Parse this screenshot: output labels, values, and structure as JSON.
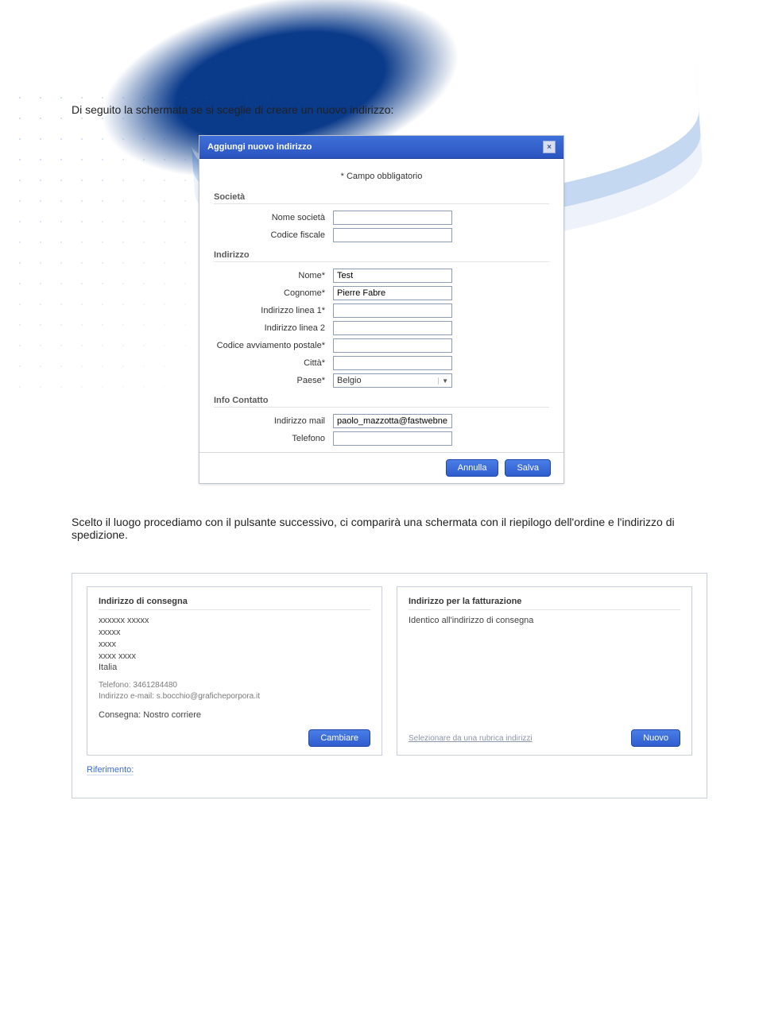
{
  "intro_text_1": "Di seguito la schermata se si sceglie di creare un nuovo indirizzo:",
  "intro_text_2": "Scelto il luogo procediamo con il pulsante successivo, ci comparirà una schermata con il riepilogo dell'ordine e l'indirizzo di spedizione.",
  "modal": {
    "title": "Aggiungi nuovo indirizzo",
    "required_note": "* Campo obbligatorio",
    "sections": {
      "societa": {
        "label": "Società",
        "nome_societa_label": "Nome società",
        "nome_societa_value": "",
        "codice_fiscale_label": "Codice fiscale",
        "codice_fiscale_value": ""
      },
      "indirizzo": {
        "label": "Indirizzo",
        "nome_label": "Nome*",
        "nome_value": "Test",
        "cognome_label": "Cognome*",
        "cognome_value": "Pierre Fabre",
        "linea1_label": "Indirizzo linea 1*",
        "linea1_value": "",
        "linea2_label": "Indirizzo linea 2",
        "linea2_value": "",
        "cap_label": "Codice avviamento postale*",
        "cap_value": "",
        "citta_label": "Città*",
        "citta_value": "",
        "paese_label": "Paese*",
        "paese_value": "Belgio"
      },
      "contatto": {
        "label": "Info Contatto",
        "mail_label": "Indirizzo mail",
        "mail_value": "paolo_mazzotta@fastwebne",
        "tel_label": "Telefono",
        "tel_value": ""
      }
    },
    "buttons": {
      "annulla": "Annulla",
      "salva": "Salva"
    }
  },
  "panel": {
    "consegna": {
      "title": "Indirizzo di consegna",
      "line1": "xxxxxx xxxxx",
      "line2": "xxxxx",
      "line3": "xxxx",
      "line4": "xxxx xxxx",
      "line5": "Italia",
      "tel": "Telefono: 3461284480",
      "mail": "Indirizzo e-mail: s.bocchio@graficheporpora.it",
      "shipping": "Consegna: Nostro corriere",
      "btn": "Cambiare"
    },
    "fatturazione": {
      "title": "Indirizzo per la fatturazione",
      "same": "Identico all'indirizzo di consegna",
      "select_link": "Selezionare da una rubrica indirizzi",
      "btn": "Nuovo"
    },
    "riferimento_label": "Riferimento:"
  }
}
